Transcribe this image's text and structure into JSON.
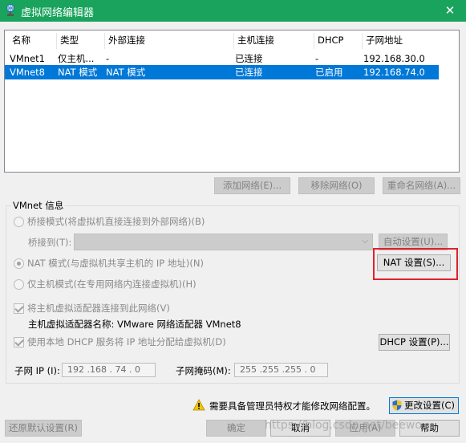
{
  "window": {
    "title": "虚拟网络编辑器",
    "close_glyph": "✕",
    "accent_color": "#19a35d"
  },
  "network_table": {
    "columns": [
      "名称",
      "类型",
      "外部连接",
      "主机连接",
      "DHCP",
      "子网地址"
    ],
    "rows": [
      [
        "VMnet1",
        "仅主机...",
        "-",
        "已连接",
        "-",
        "192.168.30.0"
      ],
      [
        "VMnet8",
        "NAT 模式",
        "NAT 模式",
        "已连接",
        "已启用",
        "192.168.74.0"
      ]
    ],
    "selected_row": 1,
    "selection_color": "#0078d7"
  },
  "table_buttons": {
    "add": "添加网络(E)...",
    "remove": "移除网络(O)",
    "rename": "重命名网络(A)..."
  },
  "vmnet_info": {
    "group_label": "VMnet 信息",
    "bridge_mode": "桥接模式(将虚拟机直接连接到外部网络)(B)",
    "bridge_to_label": "桥接到(T):",
    "bridge_to_value": "",
    "auto_settings": "自动设置(U)...",
    "nat_mode": "NAT 模式(与虚拟机共享主机的 IP 地址)(N)",
    "nat_settings": "NAT 设置(S)...",
    "host_only_mode": "仅主机模式(在专用网络内连接虚拟机)(H)",
    "connect_adapter": "将主机虚拟适配器连接到此网络(V)",
    "adapter_name": "主机虚拟适配器名称: VMware 网络适配器 VMnet8",
    "use_dhcp": "使用本地 DHCP 服务将 IP 地址分配给虚拟机(D)",
    "dhcp_settings": "DHCP 设置(P)...",
    "subnet_ip_label": "子网 IP (I):",
    "subnet_ip_value": "192 .168 . 74 . 0",
    "subnet_mask_label": "子网掩码(M):",
    "subnet_mask_value": "255 .255 .255 . 0",
    "highlight_color": "#e0222d"
  },
  "footer": {
    "admin_notice": "需要具备管理员特权才能修改网络配置。",
    "change_settings": "更改设置(C)",
    "restore_defaults": "还原默认设置(R)",
    "ok": "确定",
    "cancel": "取消",
    "apply": "应用(A)",
    "help": "帮助",
    "watermark": "https://blog.csdn.net/beewo..."
  }
}
